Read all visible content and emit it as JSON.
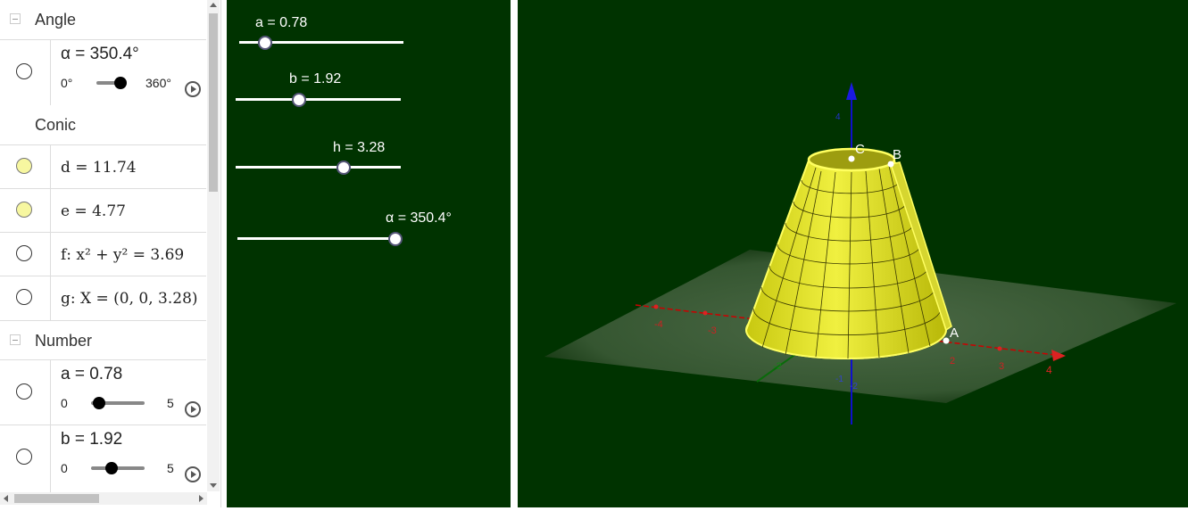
{
  "algebra": {
    "groups": {
      "angle": "Angle",
      "conic": "Conic",
      "number": "Number"
    },
    "items": {
      "alpha": {
        "label": "α = 350.4°",
        "min": "0°",
        "max": "360°",
        "value_fraction": 0.973
      },
      "d": {
        "label": "d = 11.74"
      },
      "e": {
        "label": "e = 4.77"
      },
      "f": {
        "label": "f: x² + y² = 3.69"
      },
      "g": {
        "label": "g: X = (0, 0, 3.28)"
      },
      "a": {
        "label": "a = 0.78",
        "min": "0",
        "max": "5",
        "value_fraction": 0.156
      },
      "b": {
        "label": "b = 1.92",
        "min": "0",
        "max": "5",
        "value_fraction": 0.384
      }
    }
  },
  "graphics": {
    "sliders": [
      {
        "label": "a = 0.78",
        "value_fraction": 0.156
      },
      {
        "label": "b = 1.92",
        "value_fraction": 0.384
      },
      {
        "label": "h = 3.28",
        "value_fraction": 0.656
      },
      {
        "label": "α = 350.4°",
        "value_fraction": 0.973
      }
    ]
  },
  "view3d": {
    "points": {
      "a": "A",
      "b": "B",
      "c": "C"
    },
    "x_ticks": [
      "-4",
      "-3",
      "2",
      "3",
      "4"
    ],
    "y_ticks": [
      "-2",
      "2"
    ],
    "z_ticks": [
      "4",
      "-1",
      "-2"
    ],
    "colors": {
      "background": "#003300",
      "surface": "#e8e820",
      "x_axis": "#cc0000",
      "y_axis": "#006600",
      "z_axis": "#0000cc"
    }
  }
}
